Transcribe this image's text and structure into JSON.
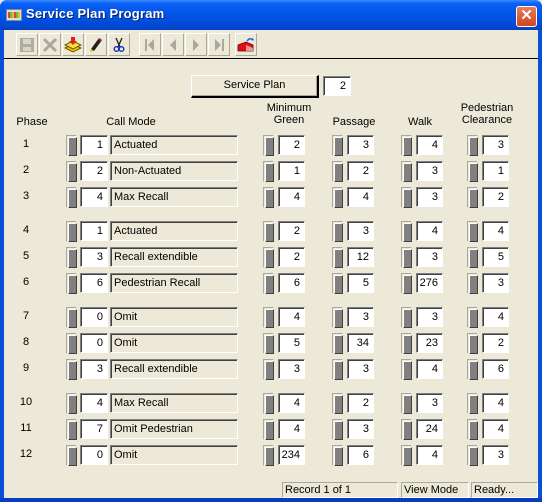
{
  "window": {
    "title": "Service Plan Program",
    "close_icon": "close-icon"
  },
  "toolbar": {
    "buttons": [
      {
        "name": "save",
        "icon": "floppy-disk-icon",
        "enabled": false
      },
      {
        "name": "delete",
        "icon": "x-cross-icon",
        "enabled": false
      },
      {
        "name": "download",
        "icon": "stack-download-icon",
        "enabled": true
      },
      {
        "name": "edit",
        "icon": "pencil-icon",
        "enabled": true
      },
      {
        "name": "cut",
        "icon": "scissors-icon",
        "enabled": true
      },
      {
        "name": "first",
        "icon": "first-record-icon",
        "enabled": false
      },
      {
        "name": "previous",
        "icon": "previous-record-icon",
        "enabled": false
      },
      {
        "name": "next",
        "icon": "next-record-icon",
        "enabled": false
      },
      {
        "name": "last",
        "icon": "last-record-icon",
        "enabled": false
      },
      {
        "name": "exit",
        "icon": "exit-door-icon",
        "enabled": true
      }
    ]
  },
  "service_plan": {
    "button_label": "Service Plan",
    "value": "2"
  },
  "headers": {
    "phase": "Phase",
    "call_mode": "Call Mode",
    "min_green_line1": "Minimum",
    "min_green_line2": "Green",
    "passage": "Passage",
    "walk": "Walk",
    "ped_clear_line1": "Pedestrian",
    "ped_clear_line2": "Clearance"
  },
  "phases": [
    {
      "phase": "1",
      "call_mode_code": "1",
      "call_mode": "Actuated",
      "min_green": "2",
      "passage": "3",
      "walk": "4",
      "ped_clearance": "3"
    },
    {
      "phase": "2",
      "call_mode_code": "2",
      "call_mode": "Non-Actuated",
      "min_green": "1",
      "passage": "2",
      "walk": "3",
      "ped_clearance": "1"
    },
    {
      "phase": "3",
      "call_mode_code": "4",
      "call_mode": "Max Recall",
      "min_green": "4",
      "passage": "4",
      "walk": "3",
      "ped_clearance": "2"
    },
    {
      "phase": "4",
      "call_mode_code": "1",
      "call_mode": "Actuated",
      "min_green": "2",
      "passage": "3",
      "walk": "4",
      "ped_clearance": "4"
    },
    {
      "phase": "5",
      "call_mode_code": "3",
      "call_mode": "Recall extendible",
      "min_green": "2",
      "passage": "12",
      "walk": "3",
      "ped_clearance": "5"
    },
    {
      "phase": "6",
      "call_mode_code": "6",
      "call_mode": "Pedestrian Recall",
      "min_green": "6",
      "passage": "5",
      "walk": "276",
      "ped_clearance": "3"
    },
    {
      "phase": "7",
      "call_mode_code": "0",
      "call_mode": "Omit",
      "min_green": "4",
      "passage": "3",
      "walk": "3",
      "ped_clearance": "4"
    },
    {
      "phase": "8",
      "call_mode_code": "0",
      "call_mode": "Omit",
      "min_green": "5",
      "passage": "34",
      "walk": "23",
      "ped_clearance": "2"
    },
    {
      "phase": "9",
      "call_mode_code": "3",
      "call_mode": "Recall extendible",
      "min_green": "3",
      "passage": "3",
      "walk": "4",
      "ped_clearance": "6"
    },
    {
      "phase": "10",
      "call_mode_code": "4",
      "call_mode": "Max Recall",
      "min_green": "4",
      "passage": "2",
      "walk": "3",
      "ped_clearance": "4"
    },
    {
      "phase": "11",
      "call_mode_code": "7",
      "call_mode": "Omit Pedestrian",
      "min_green": "4",
      "passage": "3",
      "walk": "24",
      "ped_clearance": "4"
    },
    {
      "phase": "12",
      "call_mode_code": "0",
      "call_mode": "Omit",
      "min_green": "234",
      "passage": "6",
      "walk": "4",
      "ped_clearance": "3"
    }
  ],
  "status_bar": {
    "record": "Record 1 of 1",
    "mode": "View Mode",
    "state": "Ready..."
  }
}
